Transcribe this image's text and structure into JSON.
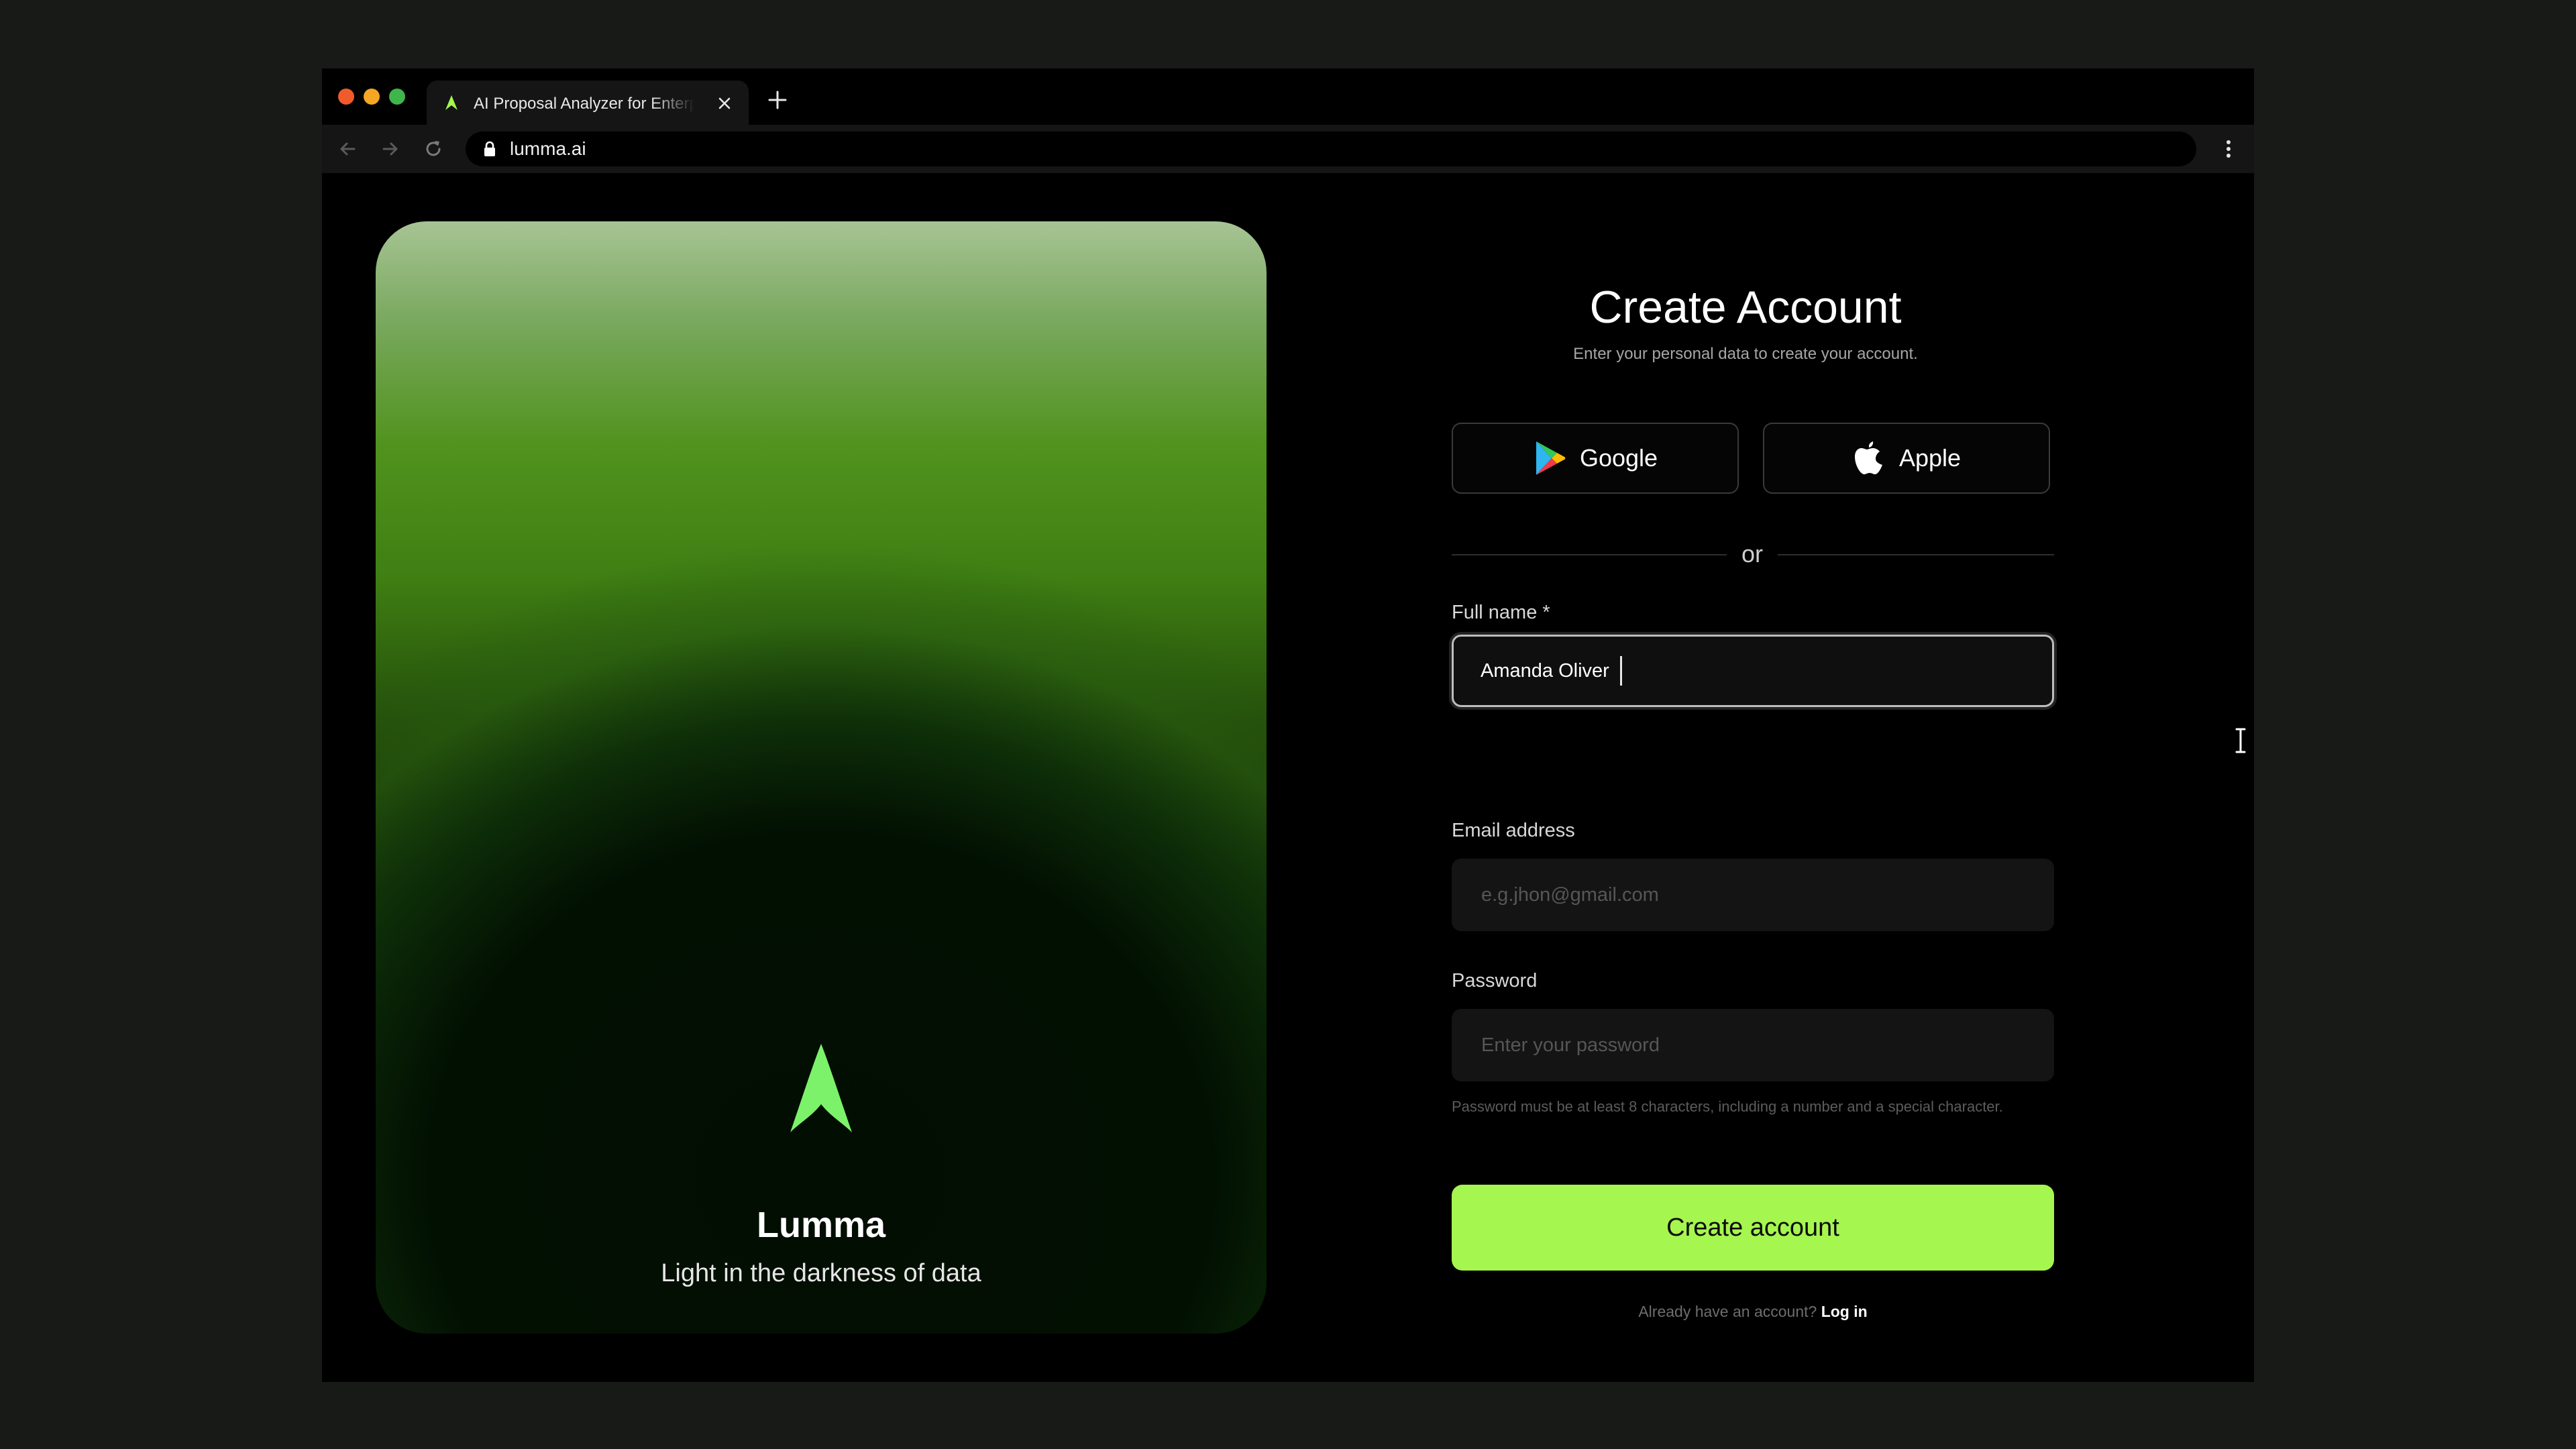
{
  "browser": {
    "tab_title": "AI Proposal Analyzer for Enterprise",
    "url": "lumma.ai",
    "accent_color": "#a5f64f"
  },
  "hero": {
    "brand_name": "Lumma",
    "tagline": "Light in the darkness of data",
    "logo_icon": "lumma-logo-icon"
  },
  "form": {
    "title": "Create Account",
    "subtitle": "Enter your personal data to create your account.",
    "social": {
      "google_label": "Google",
      "google_icon": "google-play-icon",
      "apple_label": "Apple",
      "apple_icon": "apple-icon"
    },
    "divider_text": "or",
    "full_name": {
      "label": "Full name *",
      "value": "Amanda Oliver"
    },
    "email": {
      "label": "Email address",
      "placeholder": "e.g.jhon@gmail.com",
      "value": ""
    },
    "password": {
      "label": "Password",
      "placeholder": "Enter your password",
      "hint": "Password must be at least 8 characters, including a number and a special character.",
      "toggle_icon": "eye-off-icon"
    },
    "submit_label": "Create account",
    "footer": {
      "prompt": "Already have an account?",
      "login_link": "Log in"
    }
  }
}
